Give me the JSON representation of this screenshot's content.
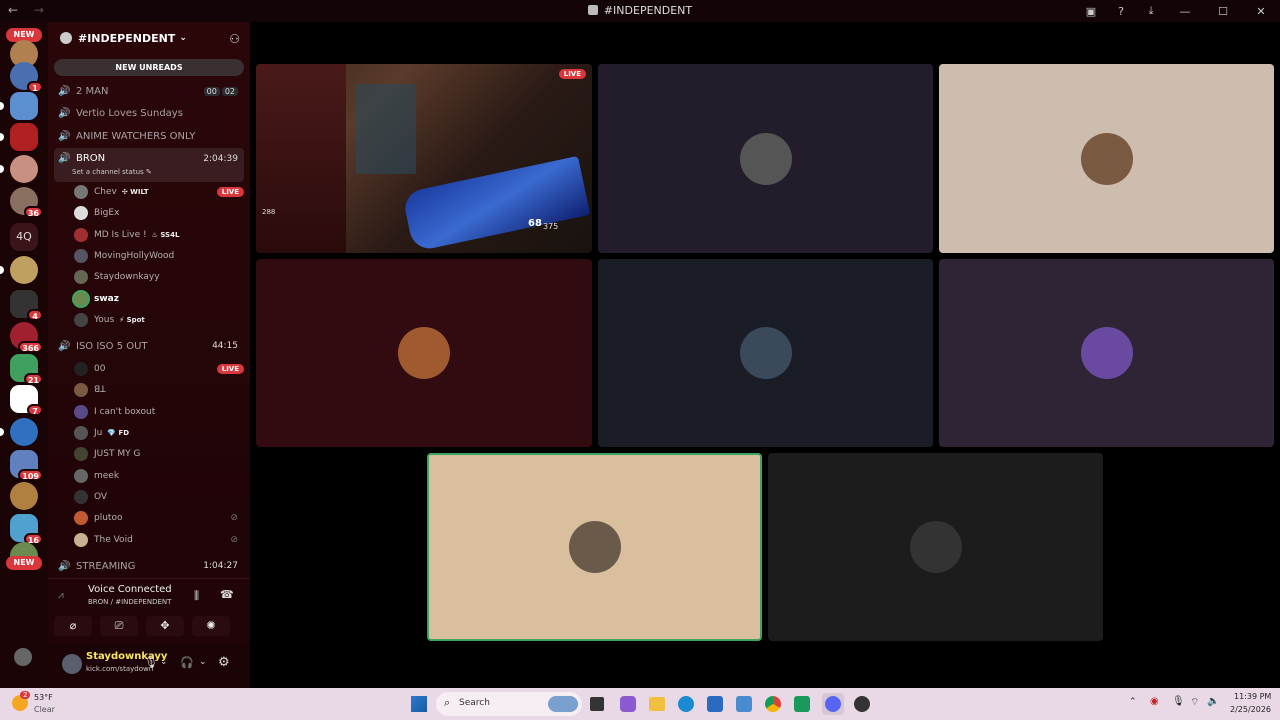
{
  "titlebar": {
    "title": "#INDEPENDENT",
    "back": "←",
    "forward": "→"
  },
  "servers": {
    "new_top": "NEW",
    "new_bottom": "NEW",
    "text_server": "4Q",
    "badges": {
      "b1": "1",
      "b36": "36",
      "b4": "4",
      "b366": "366",
      "b21": "21",
      "b7": "7",
      "b109": "109",
      "b16": "16"
    }
  },
  "guild": {
    "name": "#INDEPENDENT",
    "new_unreads": "NEW UNREADS"
  },
  "channels": {
    "c1": {
      "name": "2 MAN",
      "tags": [
        "00",
        "02"
      ]
    },
    "c2": {
      "name": "Vertio Loves Sundays"
    },
    "c3": {
      "name": "ANIME WATCHERS ONLY"
    },
    "c4": {
      "name": "BRON",
      "time": "2:04:39",
      "status": "Set a channel status"
    },
    "c5": {
      "name": "ISO ISO 5 OUT",
      "time": "44:15"
    },
    "c6": {
      "name": "STREAMING",
      "time": "1:04:27"
    }
  },
  "bron_users": [
    {
      "name": "Chev",
      "tag": "WILT",
      "live": "LIVE"
    },
    {
      "name": "BigEx"
    },
    {
      "name": "MD Is Live !",
      "tag": "SS4L"
    },
    {
      "name": "MovingHollyWood"
    },
    {
      "name": "Staydownkayy"
    },
    {
      "name": "swaz"
    },
    {
      "name": "Yous",
      "tag": "Spot"
    }
  ],
  "iso_users": [
    {
      "name": "00",
      "live": "LIVE"
    },
    {
      "name": "ꓭꓕ"
    },
    {
      "name": "I can't boxout"
    },
    {
      "name": "Ju",
      "tag": "FD"
    },
    {
      "name": "JUST MY G"
    },
    {
      "name": "meek"
    },
    {
      "name": "OV"
    },
    {
      "name": "plutoo"
    },
    {
      "name": "The Void"
    }
  ],
  "voice": {
    "status": "Voice Connected",
    "location": "BRON / #INDEPENDENT"
  },
  "user": {
    "name": "Staydownkayy",
    "sub": "kick.com/staydown"
  },
  "stage": {
    "live_badge": "LIVE",
    "hud_small": "288",
    "hud_ammo": "68",
    "hud_reserve": "375"
  },
  "taskbar": {
    "temp": "53°F",
    "weather": "Clear",
    "weather_badge": "2",
    "search": "Search",
    "time": "11:39 PM",
    "date": "2/25/2026"
  },
  "colors": {
    "accent_red": "#da373c",
    "sidebar": "#2a0609"
  }
}
